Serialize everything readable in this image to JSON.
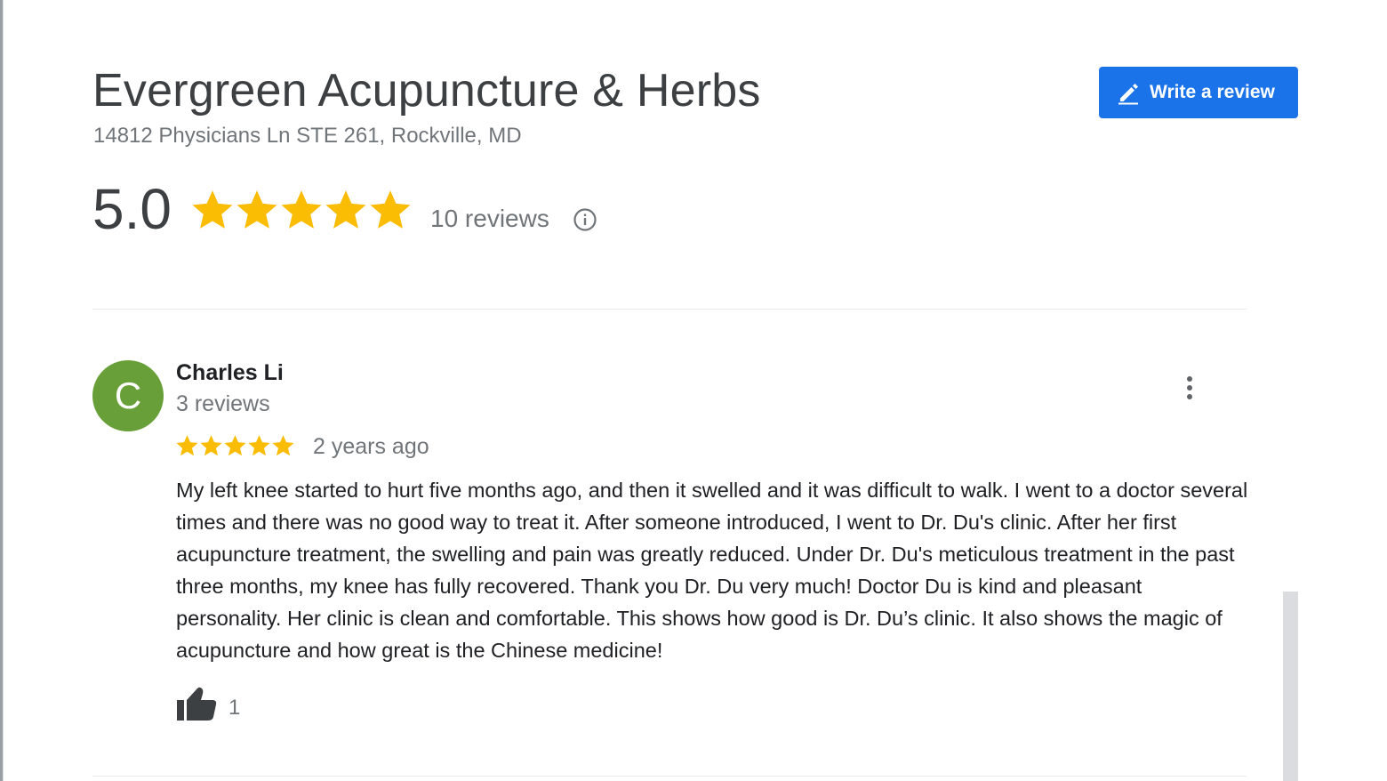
{
  "business": {
    "name": "Evergreen Acupuncture & Herbs",
    "address": "14812 Physicians Ln STE 261, Rockville, MD"
  },
  "write_review": {
    "label": "Write a review",
    "icon": "pencil-icon"
  },
  "rating": {
    "value": "5.0",
    "stars": 5,
    "review_count": "10 reviews",
    "info_icon": "info-icon"
  },
  "review": {
    "avatar_letter": "C",
    "reviewer_name": "Charles Li",
    "reviewer_meta": "3 reviews",
    "stars": 5,
    "time_ago": "2 years ago",
    "text": "My left knee started to hurt five months ago, and then it swelled and it was difficult to walk. I went to a doctor several times and there was no good way to treat it. After someone introduced, I went to Dr. Du's clinic. After her first acupuncture treatment, the swelling and pain was greatly reduced. Under Dr. Du's meticulous treatment in the past three months, my knee has fully recovered. Thank you Dr. Du very much! Doctor Du is kind and pleasant personality. Her clinic is clean and comfortable. This shows how good is Dr. Du’s clinic. It also shows the magic of acupuncture and how great is the Chinese medicine!",
    "likes": "1"
  },
  "colors": {
    "accent": "#1a73e8",
    "star": "#fbbc04",
    "avatar": "#689f38",
    "text": "#202124",
    "secondary_text": "#70757a"
  }
}
